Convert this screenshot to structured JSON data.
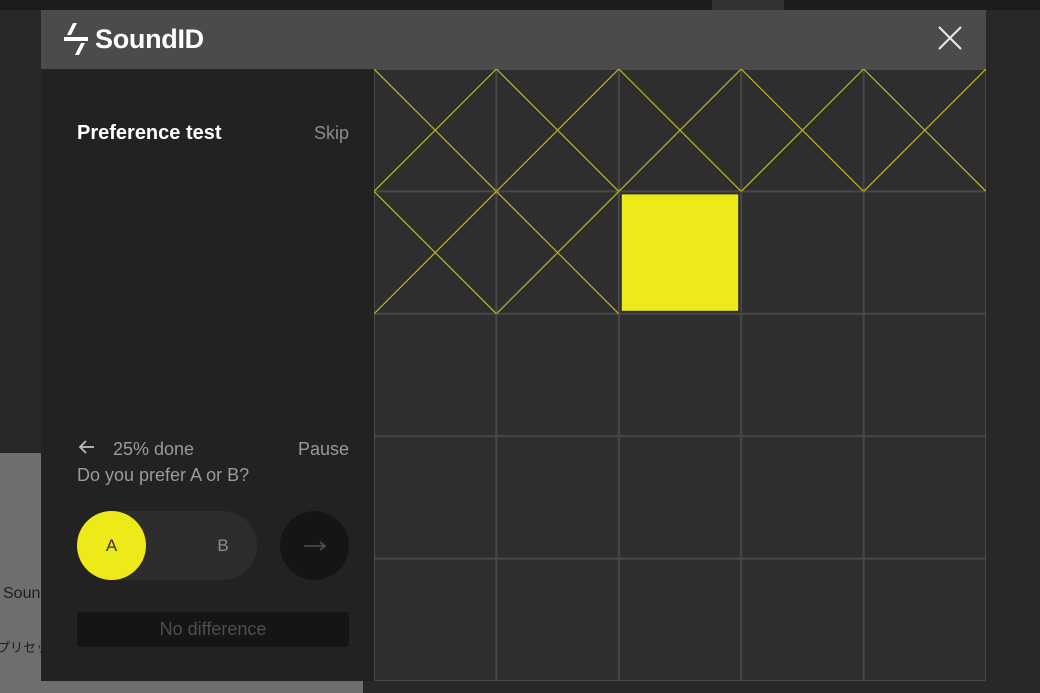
{
  "background": {
    "text1": "Soun",
    "text2": "プリセッ"
  },
  "modal": {
    "brand": "SoundID",
    "close_icon": "close-icon"
  },
  "test": {
    "title": "Preference test",
    "skip_label": "Skip",
    "progress_label": "25% done",
    "pause_label": "Pause",
    "question": "Do you prefer A or B?",
    "option_a": "A",
    "option_b": "B",
    "selected_option": "A",
    "next_icon": "arrow-right-icon",
    "back_icon": "arrow-left-icon",
    "no_difference_label": "No difference"
  },
  "progress_grid": {
    "rows": 5,
    "cols": 5,
    "total": 25,
    "completed": 7,
    "current_index": 7,
    "colors": {
      "accent": "#eeea1a",
      "cell_bg": "#2e2e2e",
      "grid_line": "#4a4a4a",
      "cross": "#bdb71e"
    }
  }
}
